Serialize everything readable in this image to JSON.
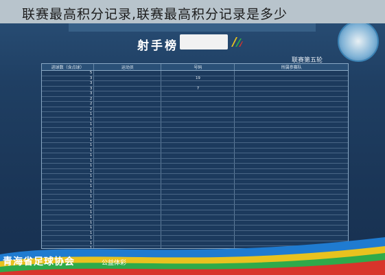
{
  "caption": "联赛最高积分记录,联赛最高积分记录是多少",
  "board": {
    "title": "射手榜",
    "season_label": "联赛第五轮"
  },
  "table": {
    "headers": [
      "进球数（含点球）",
      "运动员",
      "号码",
      "所属参赛队"
    ],
    "rows": [
      [
        "5",
        "",
        "",
        ""
      ],
      [
        "3",
        "",
        "19",
        ""
      ],
      [
        "3",
        "",
        "",
        ""
      ],
      [
        "3",
        "",
        "7",
        ""
      ],
      [
        "3",
        "",
        "",
        ""
      ],
      [
        "2",
        "",
        "",
        ""
      ],
      [
        "2",
        "",
        "",
        ""
      ],
      [
        "2",
        "",
        "",
        ""
      ],
      [
        "1",
        "",
        "",
        ""
      ],
      [
        "1",
        "",
        "",
        ""
      ],
      [
        "1",
        "",
        "",
        ""
      ],
      [
        "1",
        "",
        "",
        ""
      ],
      [
        "1",
        "",
        "",
        ""
      ],
      [
        "1",
        "",
        "",
        ""
      ],
      [
        "1",
        "",
        "",
        ""
      ],
      [
        "1",
        "",
        "",
        ""
      ],
      [
        "1",
        "",
        "",
        ""
      ],
      [
        "1",
        "",
        "",
        ""
      ],
      [
        "1",
        "",
        "",
        ""
      ],
      [
        "1",
        "",
        "",
        ""
      ],
      [
        "1",
        "",
        "",
        ""
      ],
      [
        "1",
        "",
        "",
        ""
      ],
      [
        "1",
        "",
        "",
        ""
      ],
      [
        "1",
        "",
        "",
        ""
      ],
      [
        "1",
        "",
        "",
        ""
      ],
      [
        "1",
        "",
        "",
        ""
      ],
      [
        "1",
        "",
        "",
        ""
      ],
      [
        "1",
        "",
        "",
        ""
      ],
      [
        "1",
        "",
        "",
        ""
      ],
      [
        "1",
        "",
        "",
        ""
      ],
      [
        "1",
        "",
        "",
        ""
      ],
      [
        "1",
        "",
        "",
        ""
      ],
      [
        "1",
        "",
        "",
        ""
      ],
      [
        "1",
        "",
        "",
        ""
      ],
      [
        "1",
        "",
        "",
        ""
      ],
      [
        "1",
        "",
        "",
        ""
      ]
    ]
  },
  "footer": {
    "left_text": "公益体彩",
    "right_text": "青海省足球协会"
  },
  "colors": {
    "board_bg": "#1e3a5c",
    "caption_band": "#b8c4cc",
    "ribbon_colors": [
      "#1f7bd0",
      "#e8c21f",
      "#2faa4a",
      "#d8342b"
    ]
  }
}
